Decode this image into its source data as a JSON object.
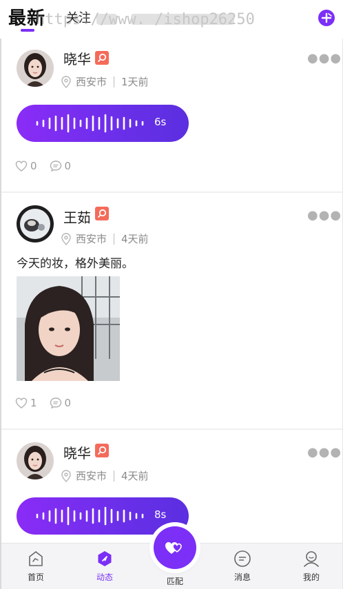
{
  "header": {
    "tab_latest": "最新",
    "tab_follow": "关注",
    "watermark": "https://www.                  /ishop26250"
  },
  "posts": [
    {
      "username": "晓华",
      "location": "西安市",
      "time": "1天前",
      "voice_duration": "6s",
      "likes": "0",
      "comments": "0"
    },
    {
      "username": "王茹",
      "location": "西安市",
      "time": "4天前",
      "text": "今天的妆，格外美丽。",
      "likes": "1",
      "comments": "0"
    },
    {
      "username": "晓华",
      "location": "西安市",
      "time": "4天前",
      "voice_duration": "8s"
    }
  ],
  "nav": {
    "home": "首页",
    "feed": "动态",
    "match": "匹配",
    "messages": "消息",
    "mine": "我的"
  },
  "colors": {
    "accent": "#7b2ff7",
    "badge": "#f46b5a",
    "muted": "#8a8a8a"
  },
  "icons": {
    "publish": "plus-icon",
    "location": "location-pin-icon",
    "like": "heart-outline-icon",
    "comment": "comment-icon",
    "more": "more-dots-icon"
  }
}
